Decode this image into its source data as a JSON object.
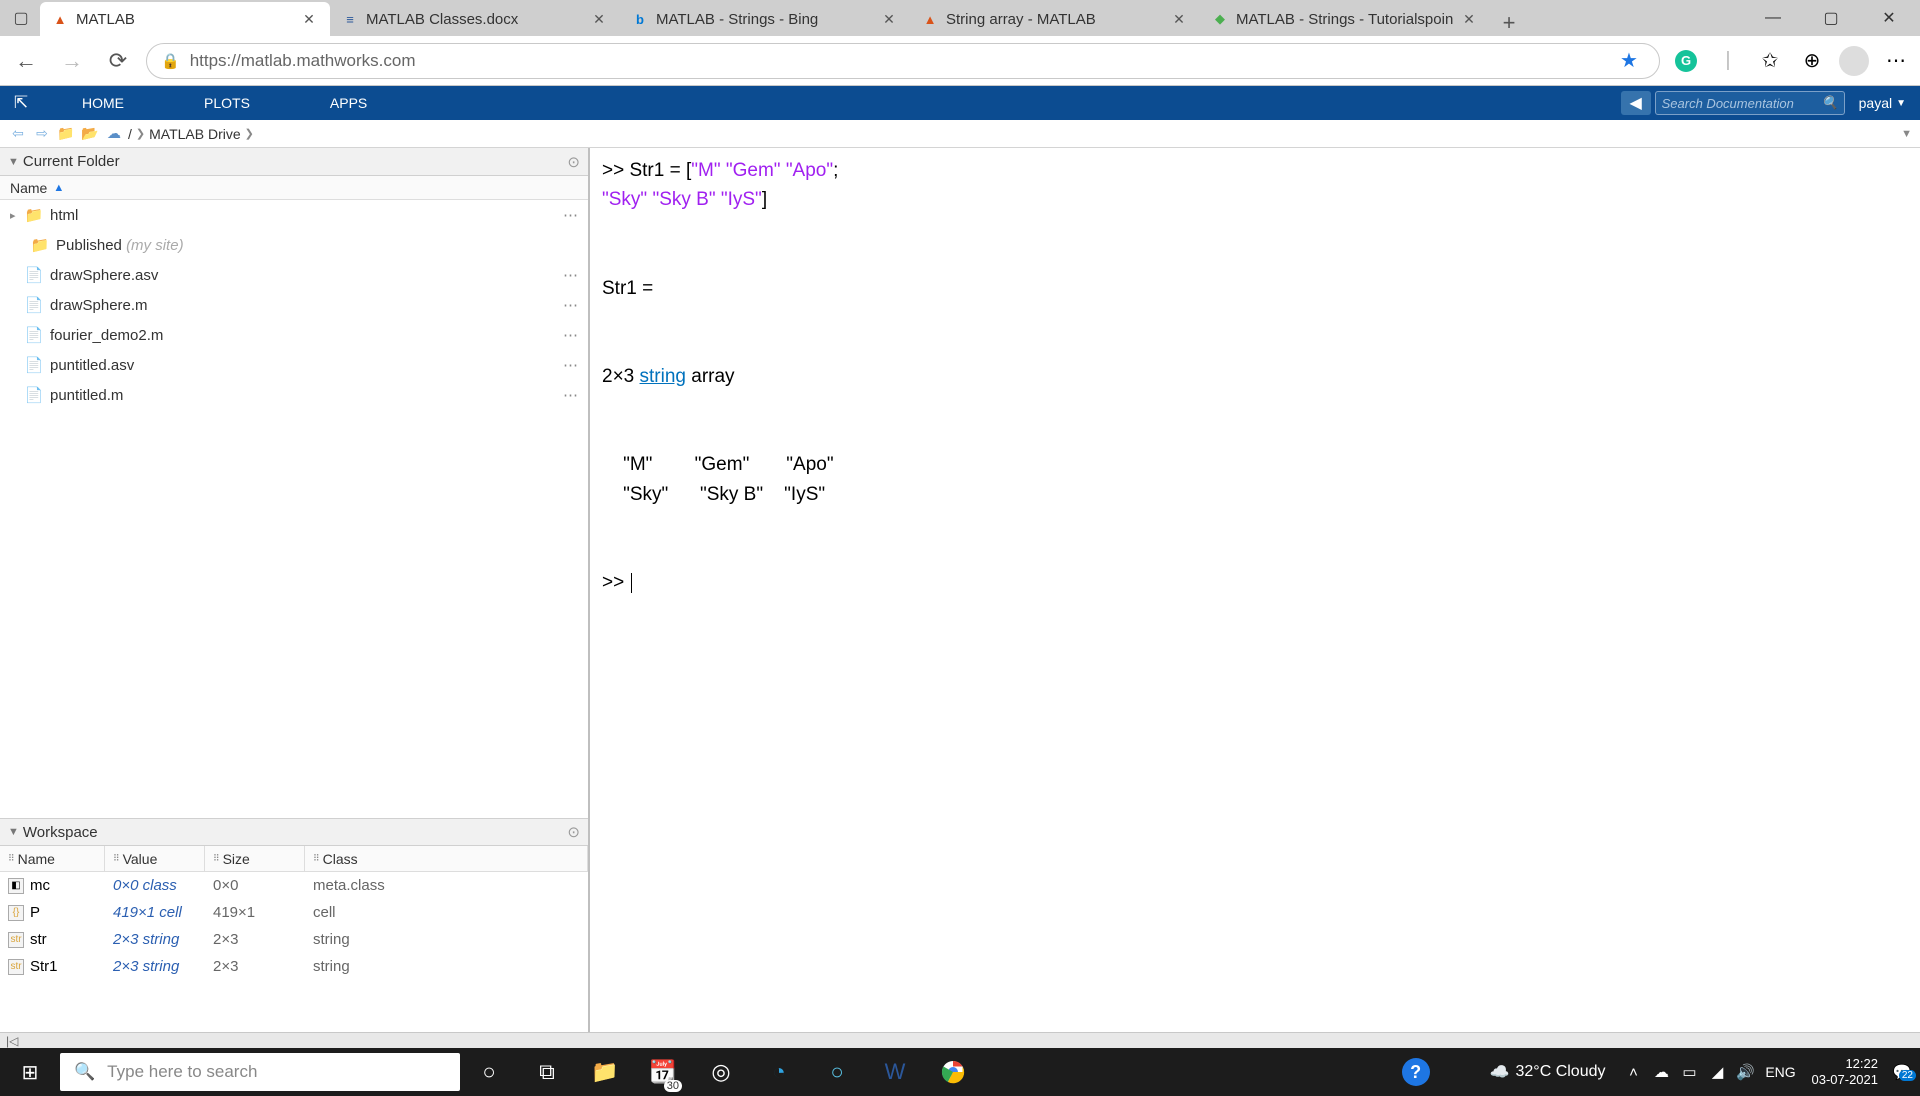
{
  "browser": {
    "tabs": [
      {
        "label": "MATLAB",
        "fav": "▲",
        "favColor": "#d95319"
      },
      {
        "label": "MATLAB Classes.docx",
        "fav": "≡",
        "favColor": "#2b579a"
      },
      {
        "label": "MATLAB - Strings - Bing",
        "fav": "b",
        "favColor": "#0078d4"
      },
      {
        "label": "String array - MATLAB",
        "fav": "▲",
        "favColor": "#d95319"
      },
      {
        "label": "MATLAB - Strings - Tutorialspoin",
        "fav": "◆",
        "favColor": "#4caf50"
      }
    ],
    "url": "https://matlab.mathworks.com"
  },
  "toolstrip": {
    "tabs": [
      "HOME",
      "PLOTS",
      "APPS"
    ],
    "searchPlaceholder": "Search Documentation",
    "user": "payal"
  },
  "path": {
    "drive": "MATLAB Drive"
  },
  "currentFolder": {
    "title": "Current Folder",
    "header": "Name",
    "items": [
      {
        "name": "html",
        "type": "folder",
        "expandable": true
      },
      {
        "name": "Published",
        "hint": "(my site)",
        "type": "folder",
        "sub": true
      },
      {
        "name": "drawSphere.asv",
        "type": "file"
      },
      {
        "name": "drawSphere.m",
        "type": "mfile"
      },
      {
        "name": "fourier_demo2.m",
        "type": "mfile"
      },
      {
        "name": "puntitled.asv",
        "type": "file"
      },
      {
        "name": "puntitled.m",
        "type": "mfile"
      }
    ]
  },
  "workspace": {
    "title": "Workspace",
    "cols": [
      "Name",
      "Value",
      "Size",
      "Class"
    ],
    "rows": [
      {
        "name": "mc",
        "value": "0×0 class",
        "size": "0×0",
        "class": "meta.class"
      },
      {
        "name": "P",
        "value": "419×1 cell",
        "size": "419×1",
        "class": "cell"
      },
      {
        "name": "str",
        "value": "2×3 string",
        "size": "2×3",
        "class": "string"
      },
      {
        "name": "Str1",
        "value": "2×3 string",
        "size": "2×3",
        "class": "string"
      }
    ]
  },
  "command": {
    "line1_prefix": ">> Str1 = [",
    "line1_s1": "\"M\"",
    "line1_sp1": " ",
    "line1_s2": "\"Gem\"",
    "line1_sp2": " ",
    "line1_s3": "\"Apo\"",
    "line1_suffix": ";",
    "line2_s1": "\"Sky\"",
    "line2_sp1": " ",
    "line2_s2": "\"Sky B\"",
    "line2_sp2": " ",
    "line2_s3": "\"IyS\"",
    "line2_suffix": "]",
    "outName": "Str1 =",
    "dim_prefix": "  2×3 ",
    "dim_kw": "string",
    "dim_suffix": " array",
    "row1": "    \"M\"        \"Gem\"       \"Apo\"",
    "row2": "    \"Sky\"      \"Sky B\"    \"IyS\"",
    "prompt": ">> "
  },
  "taskbar": {
    "search": "Type here to search",
    "weather": "32°C  Cloudy",
    "lang": "ENG",
    "time": "12:22",
    "date": "03-07-2021",
    "badge": "22",
    "calendarDay": "30"
  }
}
